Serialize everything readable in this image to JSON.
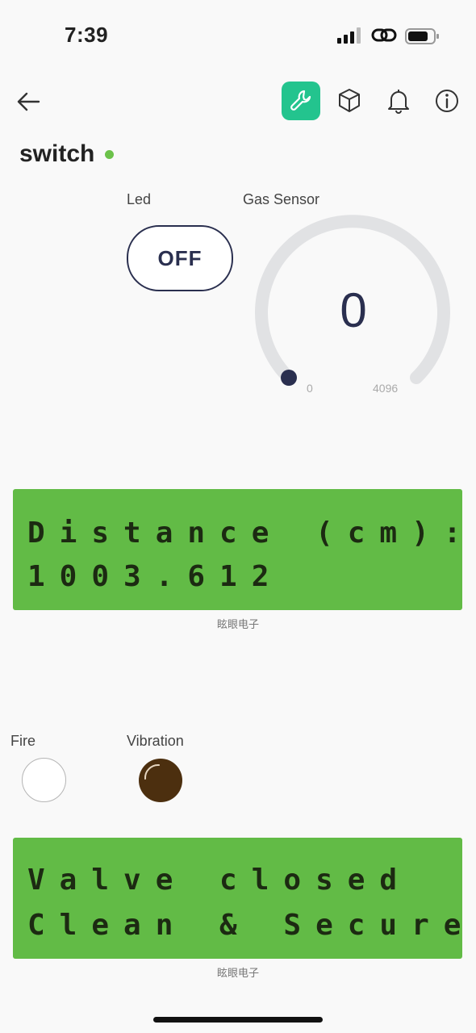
{
  "status_bar": {
    "time": "7:39"
  },
  "header": {
    "title": "switch",
    "online_color": "#6cc24a"
  },
  "nav_icons": [
    "back-arrow-icon",
    "wrench-icon",
    "cube-icon",
    "bell-icon",
    "info-icon"
  ],
  "widgets": {
    "led": {
      "label": "Led",
      "state": "OFF"
    },
    "gas": {
      "label": "Gas Sensor",
      "value": "0",
      "min": "0",
      "max": "4096"
    },
    "lcd1": {
      "line1": "Distance (cm):",
      "line2": "1003.612",
      "caption": "眩眼电子"
    },
    "fire": {
      "label": "Fire",
      "color": "#ffffff"
    },
    "vibration": {
      "label": "Vibration",
      "color": "#4c2f0f"
    },
    "lcd2": {
      "line1": "Valve closed",
      "line2": "Clean & Secure",
      "caption": "眩眼电子"
    }
  },
  "colors": {
    "accent": "#23c48e",
    "lcd_bg": "#62bb46",
    "gauge_track": "#e1e2e4",
    "gauge_knob": "#2a2f4f"
  }
}
